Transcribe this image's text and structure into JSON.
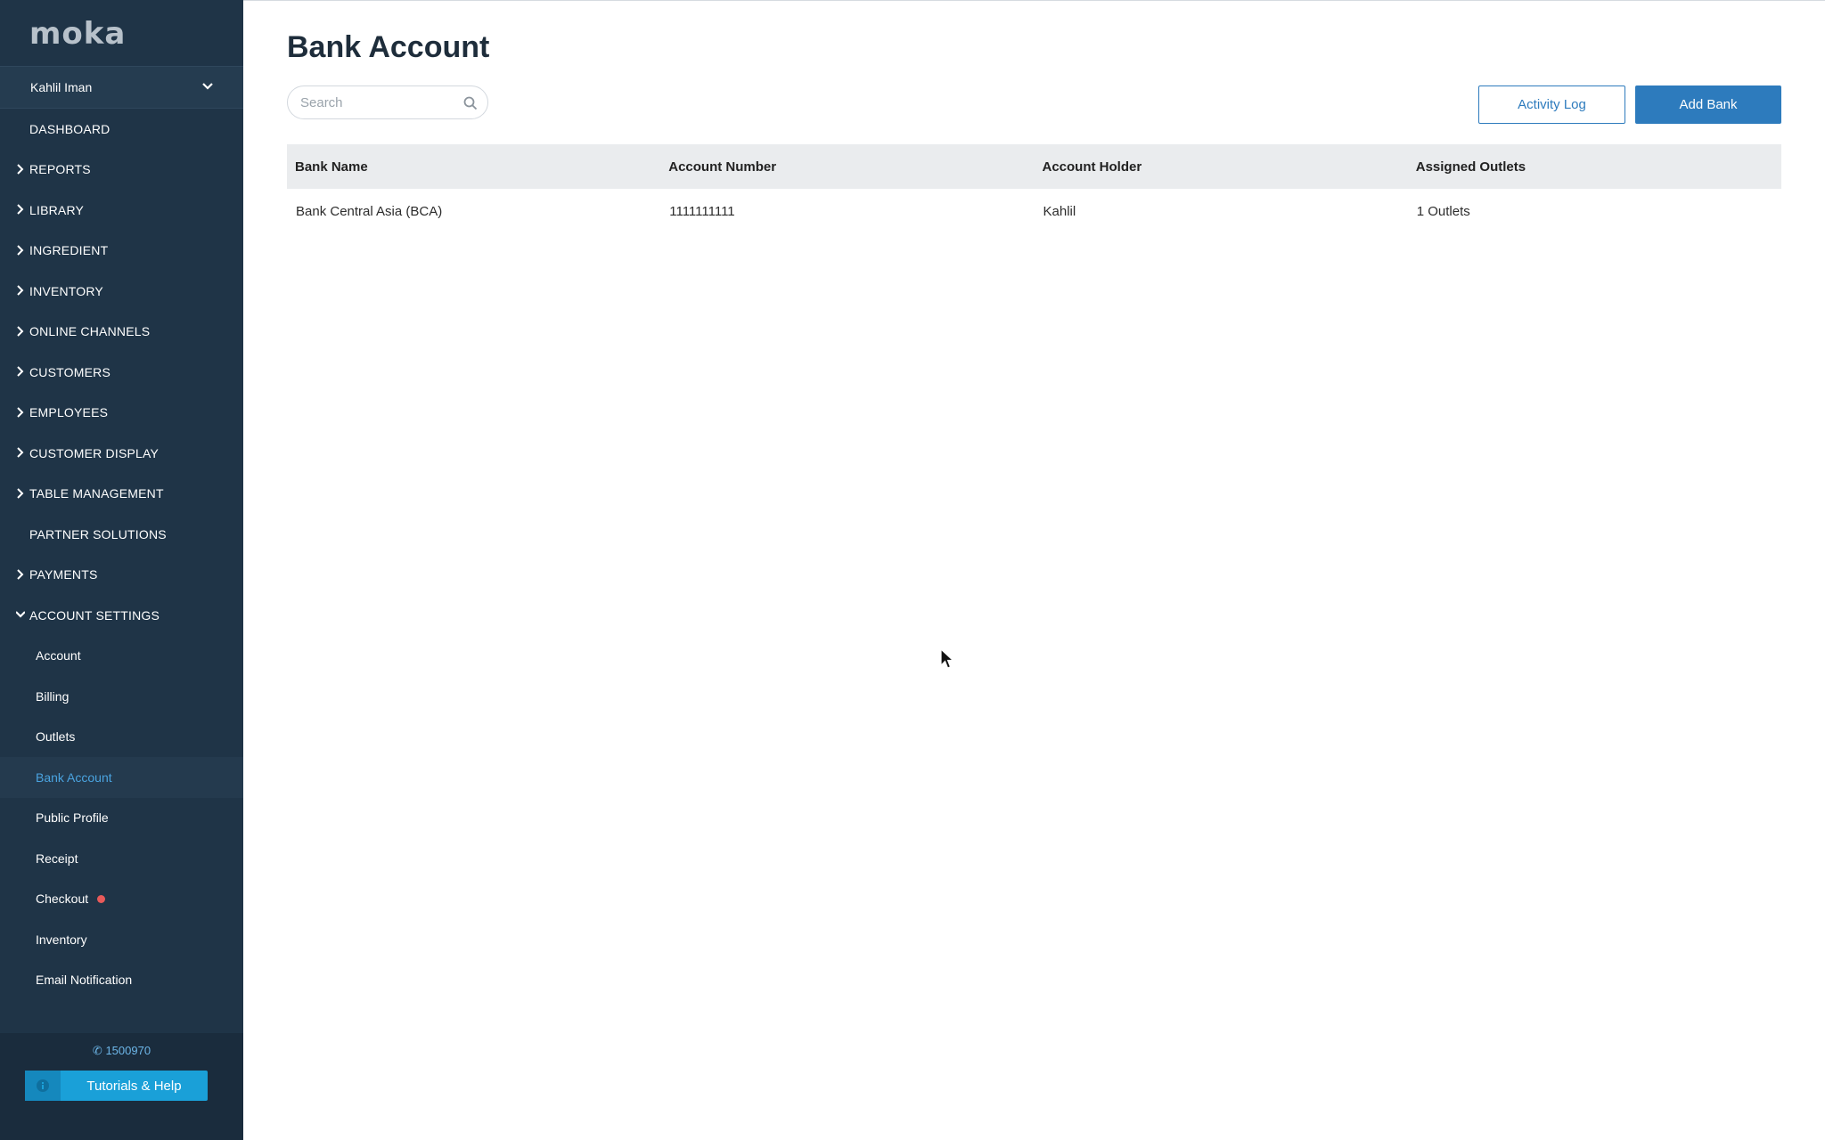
{
  "sidebar": {
    "logo": "moka",
    "user": "Kahlil Iman",
    "nav": [
      {
        "label": "DASHBOARD",
        "caret": "none"
      },
      {
        "label": "REPORTS",
        "caret": "right"
      },
      {
        "label": "LIBRARY",
        "caret": "right"
      },
      {
        "label": "INGREDIENT",
        "caret": "right"
      },
      {
        "label": "INVENTORY",
        "caret": "right"
      },
      {
        "label": "ONLINE CHANNELS",
        "caret": "right"
      },
      {
        "label": "CUSTOMERS",
        "caret": "right"
      },
      {
        "label": "EMPLOYEES",
        "caret": "right"
      },
      {
        "label": "CUSTOMER DISPLAY",
        "caret": "right"
      },
      {
        "label": "TABLE MANAGEMENT",
        "caret": "right"
      },
      {
        "label": "PARTNER SOLUTIONS",
        "caret": "none"
      },
      {
        "label": "PAYMENTS",
        "caret": "right"
      },
      {
        "label": "ACCOUNT SETTINGS",
        "caret": "down"
      }
    ],
    "account_settings_items": [
      {
        "label": "Account"
      },
      {
        "label": "Billing"
      },
      {
        "label": "Outlets"
      },
      {
        "label": "Bank Account",
        "active": true
      },
      {
        "label": "Public Profile"
      },
      {
        "label": "Receipt"
      },
      {
        "label": "Checkout",
        "badge": "red-dot"
      },
      {
        "label": "Inventory"
      },
      {
        "label": "Email Notification"
      }
    ],
    "phone": "1500970",
    "help_button": "Tutorials & Help"
  },
  "main": {
    "title": "Bank Account",
    "search": {
      "placeholder": "Search",
      "value": ""
    },
    "activity_log_label": "Activity Log",
    "add_bank_label": "Add Bank",
    "table": {
      "headers": [
        "Bank Name",
        "Account Number",
        "Account Holder",
        "Assigned Outlets"
      ],
      "rows": [
        [
          "Bank Central Asia (BCA)",
          "1111111111",
          "Kahlil",
          "1 Outlets"
        ]
      ]
    }
  },
  "colors": {
    "sidebar_bg": "#1f3447",
    "accent": "#2d7bbd",
    "active_link": "#4aa3df",
    "help_button": "#1aa0d8"
  }
}
